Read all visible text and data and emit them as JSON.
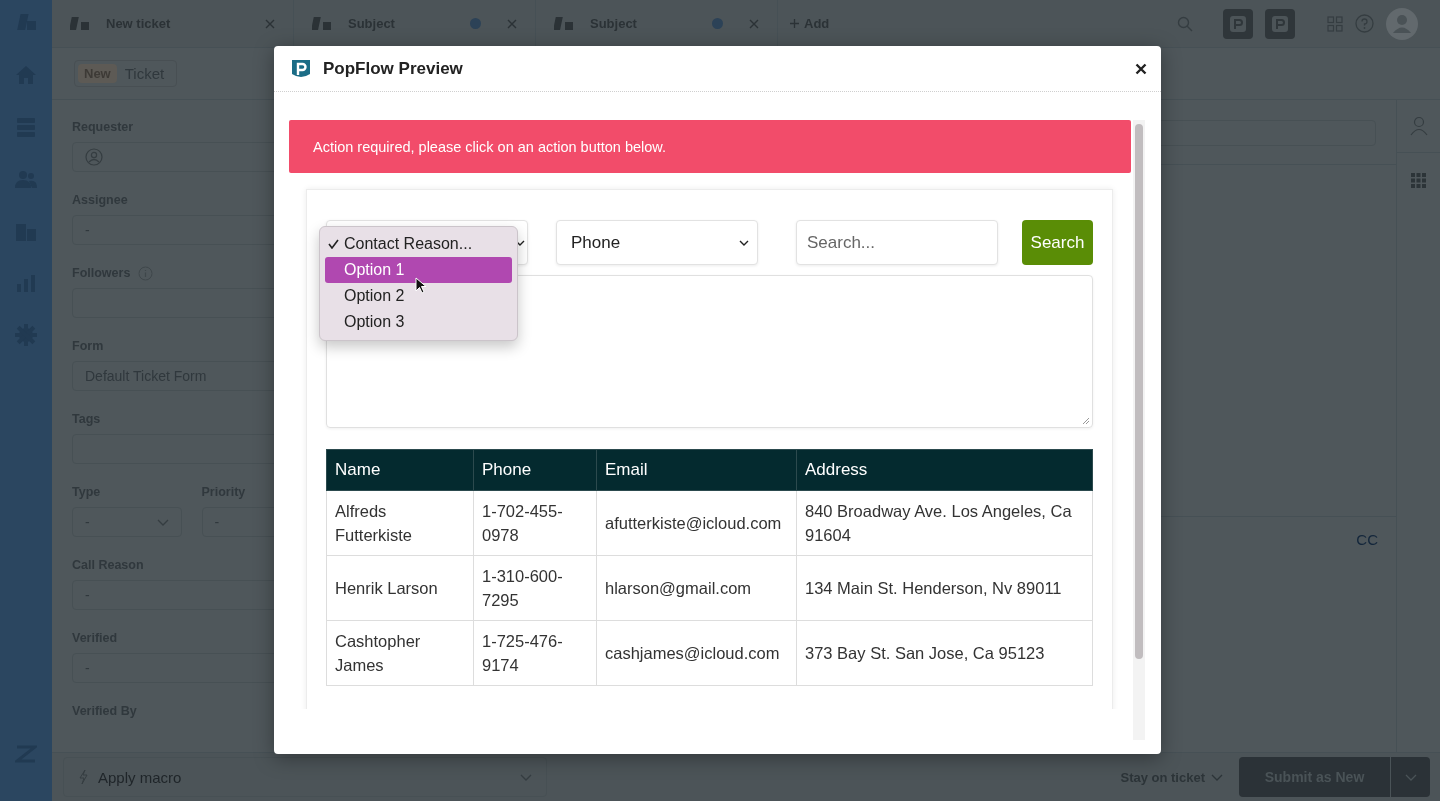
{
  "tabs": [
    {
      "label": "New ticket",
      "unsaved": false
    },
    {
      "label": "Subject",
      "unsaved": true
    },
    {
      "label": "Subject",
      "unsaved": true
    }
  ],
  "add_tab": "Add",
  "ticket_header": {
    "badge": "New",
    "title": "Ticket"
  },
  "fields": [
    {
      "kind": "user",
      "label": "Requester"
    },
    {
      "kind": "text",
      "label": "Assignee",
      "value": "-"
    },
    {
      "kind": "info",
      "label": "Followers"
    },
    {
      "kind": "text",
      "label": "Form",
      "value": "Default Ticket Form"
    },
    {
      "kind": "text",
      "label": "Tags"
    },
    {
      "kind": "row",
      "fields": [
        {
          "kind": "select",
          "label": "Type",
          "value": "-"
        },
        {
          "kind": "text",
          "label": "Priority",
          "value": "-"
        }
      ]
    },
    {
      "kind": "text",
      "label": "Call Reason",
      "value": "-"
    },
    {
      "kind": "text",
      "label": "Verified",
      "value": "-"
    },
    {
      "kind": "label",
      "label": "Verified By"
    }
  ],
  "composer": {
    "cc": "CC"
  },
  "footer": {
    "macro": {
      "placeholder": "Apply macro"
    },
    "stay": "Stay on ticket",
    "submit": "Submit as New"
  },
  "modal": {
    "title": "PopFlow Preview",
    "alert": "Action required, please click on an action button below.",
    "reason_menu": [
      {
        "label": "Contact Reason...",
        "checked": true,
        "selected": false
      },
      {
        "label": "Option 1",
        "checked": false,
        "selected": true
      },
      {
        "label": "Option 2",
        "checked": false,
        "selected": false
      },
      {
        "label": "Option 3",
        "checked": false,
        "selected": false
      }
    ],
    "search_by": "Phone",
    "search": {
      "placeholder": "Search..."
    },
    "search_button": "Search",
    "table": {
      "columns": [
        "Name",
        "Phone",
        "Email",
        "Address"
      ],
      "rows": [
        [
          "Alfreds Futterkiste",
          "1-702-455-0978",
          "afutterkiste@icloud.com",
          "840 Broadway Ave. Los Angeles, Ca 91604"
        ],
        [
          "Henrik Larson",
          "1-310-600-7295",
          "hlarson@gmail.com",
          "134 Main St. Henderson, Nv 89011"
        ],
        [
          "Cashtopher James",
          "1-725-476-9174",
          "cashjames@icloud.com",
          "373 Bay St. San Jose, Ca 95123"
        ]
      ]
    }
  }
}
